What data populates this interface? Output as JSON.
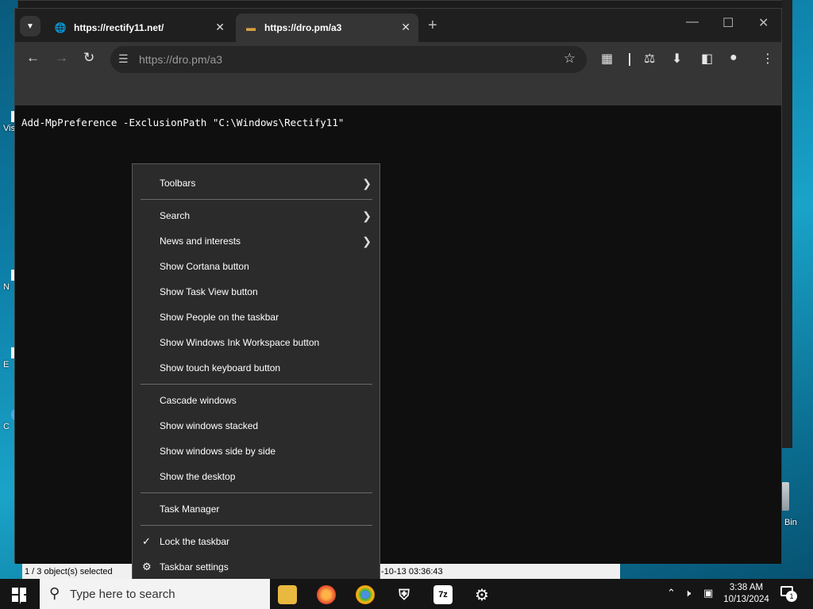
{
  "desktop": {
    "icons": [
      {
        "label": "Vis",
        "top": 0
      },
      {
        "label": "N",
        "top": 0
      },
      {
        "label": "E",
        "top": 0
      },
      {
        "label": "C",
        "top": 0
      }
    ],
    "recycle_bin_label": "Bin"
  },
  "background_window": {
    "status_left": "1 / 3 object(s) selected",
    "status_right": "-10-13 03:36:43"
  },
  "browser": {
    "tabs": [
      {
        "title": "https://rectify11.net/",
        "icon": "globe-icon",
        "active": false
      },
      {
        "title": "https://dro.pm/a3",
        "icon": "site-favicon",
        "active": true
      }
    ],
    "new_tab_label": "+",
    "address": {
      "scheme": "https://",
      "rest": "dro.pm/a3"
    },
    "page_text": "Add-MpPreference -ExclusionPath \"C:\\Windows\\Rectify11\""
  },
  "context_menu": {
    "items": [
      {
        "label": "Toolbars",
        "submenu": true
      },
      {
        "label": "Search",
        "submenu": true
      },
      {
        "label": "News and interests",
        "submenu": true
      },
      {
        "label": "Show Cortana button"
      },
      {
        "label": "Show Task View button"
      },
      {
        "label": "Show People on the taskbar"
      },
      {
        "label": "Show Windows Ink Workspace button"
      },
      {
        "label": "Show touch keyboard button"
      },
      {
        "label": "Cascade windows"
      },
      {
        "label": "Show windows stacked"
      },
      {
        "label": "Show windows side by side"
      },
      {
        "label": "Show the desktop"
      },
      {
        "label": "Task Manager"
      },
      {
        "label": "Lock the taskbar",
        "checked": true
      },
      {
        "label": "Taskbar settings",
        "icon": "gear-icon"
      }
    ]
  },
  "taskbar": {
    "search_placeholder": "Type here to search",
    "apps": [
      {
        "name": "file-explorer",
        "label": ""
      },
      {
        "name": "firefox",
        "label": ""
      },
      {
        "name": "chrome",
        "label": ""
      },
      {
        "name": "windows-security",
        "label": ""
      },
      {
        "name": "7zip",
        "label": "7z"
      },
      {
        "name": "settings",
        "label": ""
      }
    ],
    "clock_time": "3:38 AM",
    "clock_date": "10/13/2024",
    "notification_count": "1"
  },
  "colors": {
    "menu_bg": "#2b2b2b",
    "taskbar_bg": "#151515",
    "chrome_toolbar": "#353535",
    "page_bg": "#0f0f0f"
  }
}
